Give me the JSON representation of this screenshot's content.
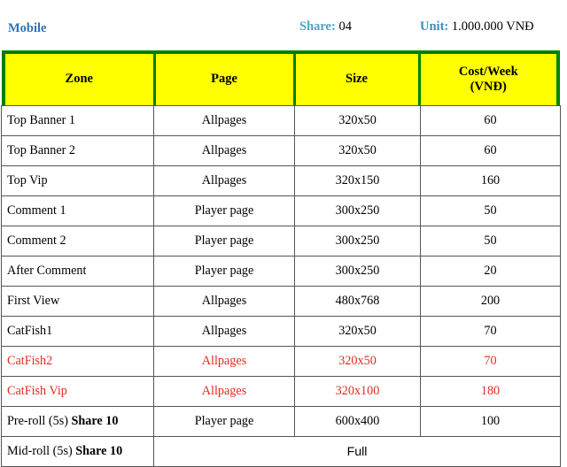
{
  "header": {
    "site_label": "Mobile",
    "share": {
      "label": "Share:",
      "value": "04"
    },
    "unit": {
      "label": "Unit:",
      "value": "1.000.000 VNĐ"
    }
  },
  "table": {
    "columns": [
      {
        "key": "zone",
        "label": "Zone"
      },
      {
        "key": "page",
        "label": "Page"
      },
      {
        "key": "size",
        "label": "Size"
      },
      {
        "key": "cost",
        "label_line1": "Cost/Week",
        "label_line2": "(VNĐ)"
      }
    ],
    "rows": [
      {
        "zone": "Top Banner 1",
        "page": "Allpages",
        "size": "320x50",
        "cost": "60",
        "color": "black"
      },
      {
        "zone": "Top Banner 2",
        "page": "Allpages",
        "size": "320x50",
        "cost": "60",
        "color": "black"
      },
      {
        "zone": "Top Vip",
        "page": "Allpages",
        "size": "320x150",
        "cost": "160",
        "color": "black"
      },
      {
        "zone": "Comment 1",
        "page": "Player page",
        "size": "300x250",
        "cost": "50",
        "color": "black"
      },
      {
        "zone": "Comment 2",
        "page": "Player page",
        "size": "300x250",
        "cost": "50",
        "color": "black"
      },
      {
        "zone": "After Comment",
        "page": "Player page",
        "size": "300x250",
        "cost": "20",
        "color": "black"
      },
      {
        "zone": "First View",
        "page": "Allpages",
        "size": "480x768",
        "cost": "200",
        "color": "black"
      },
      {
        "zone": "CatFish1",
        "page": "Allpages",
        "size": "320x50",
        "cost": "70",
        "color": "black"
      },
      {
        "zone": "CatFish2",
        "page": "Allpages",
        "size": "320x50",
        "cost": "70",
        "color": "red"
      },
      {
        "zone": "CatFish Vip",
        "page": "Allpages",
        "size": "320x100",
        "cost": "180",
        "color": "red"
      }
    ],
    "preroll_row": {
      "zone_prefix": "Pre-roll (5s) ",
      "zone_bold": "Share 10",
      "page": "Player page",
      "size": "600x400",
      "cost": "100"
    },
    "midroll_row": {
      "zone_prefix": "Mid-roll (5s) ",
      "zone_bold": "Share 10",
      "merged_value": "Full"
    }
  },
  "colors": {
    "header_fill": "#FFFF00",
    "header_border": "#008000",
    "highlight_red": "#E02B20",
    "label_blue": "#2E74B5",
    "meta_blue": "#3C8DBC",
    "grid_gray": "#555555"
  }
}
